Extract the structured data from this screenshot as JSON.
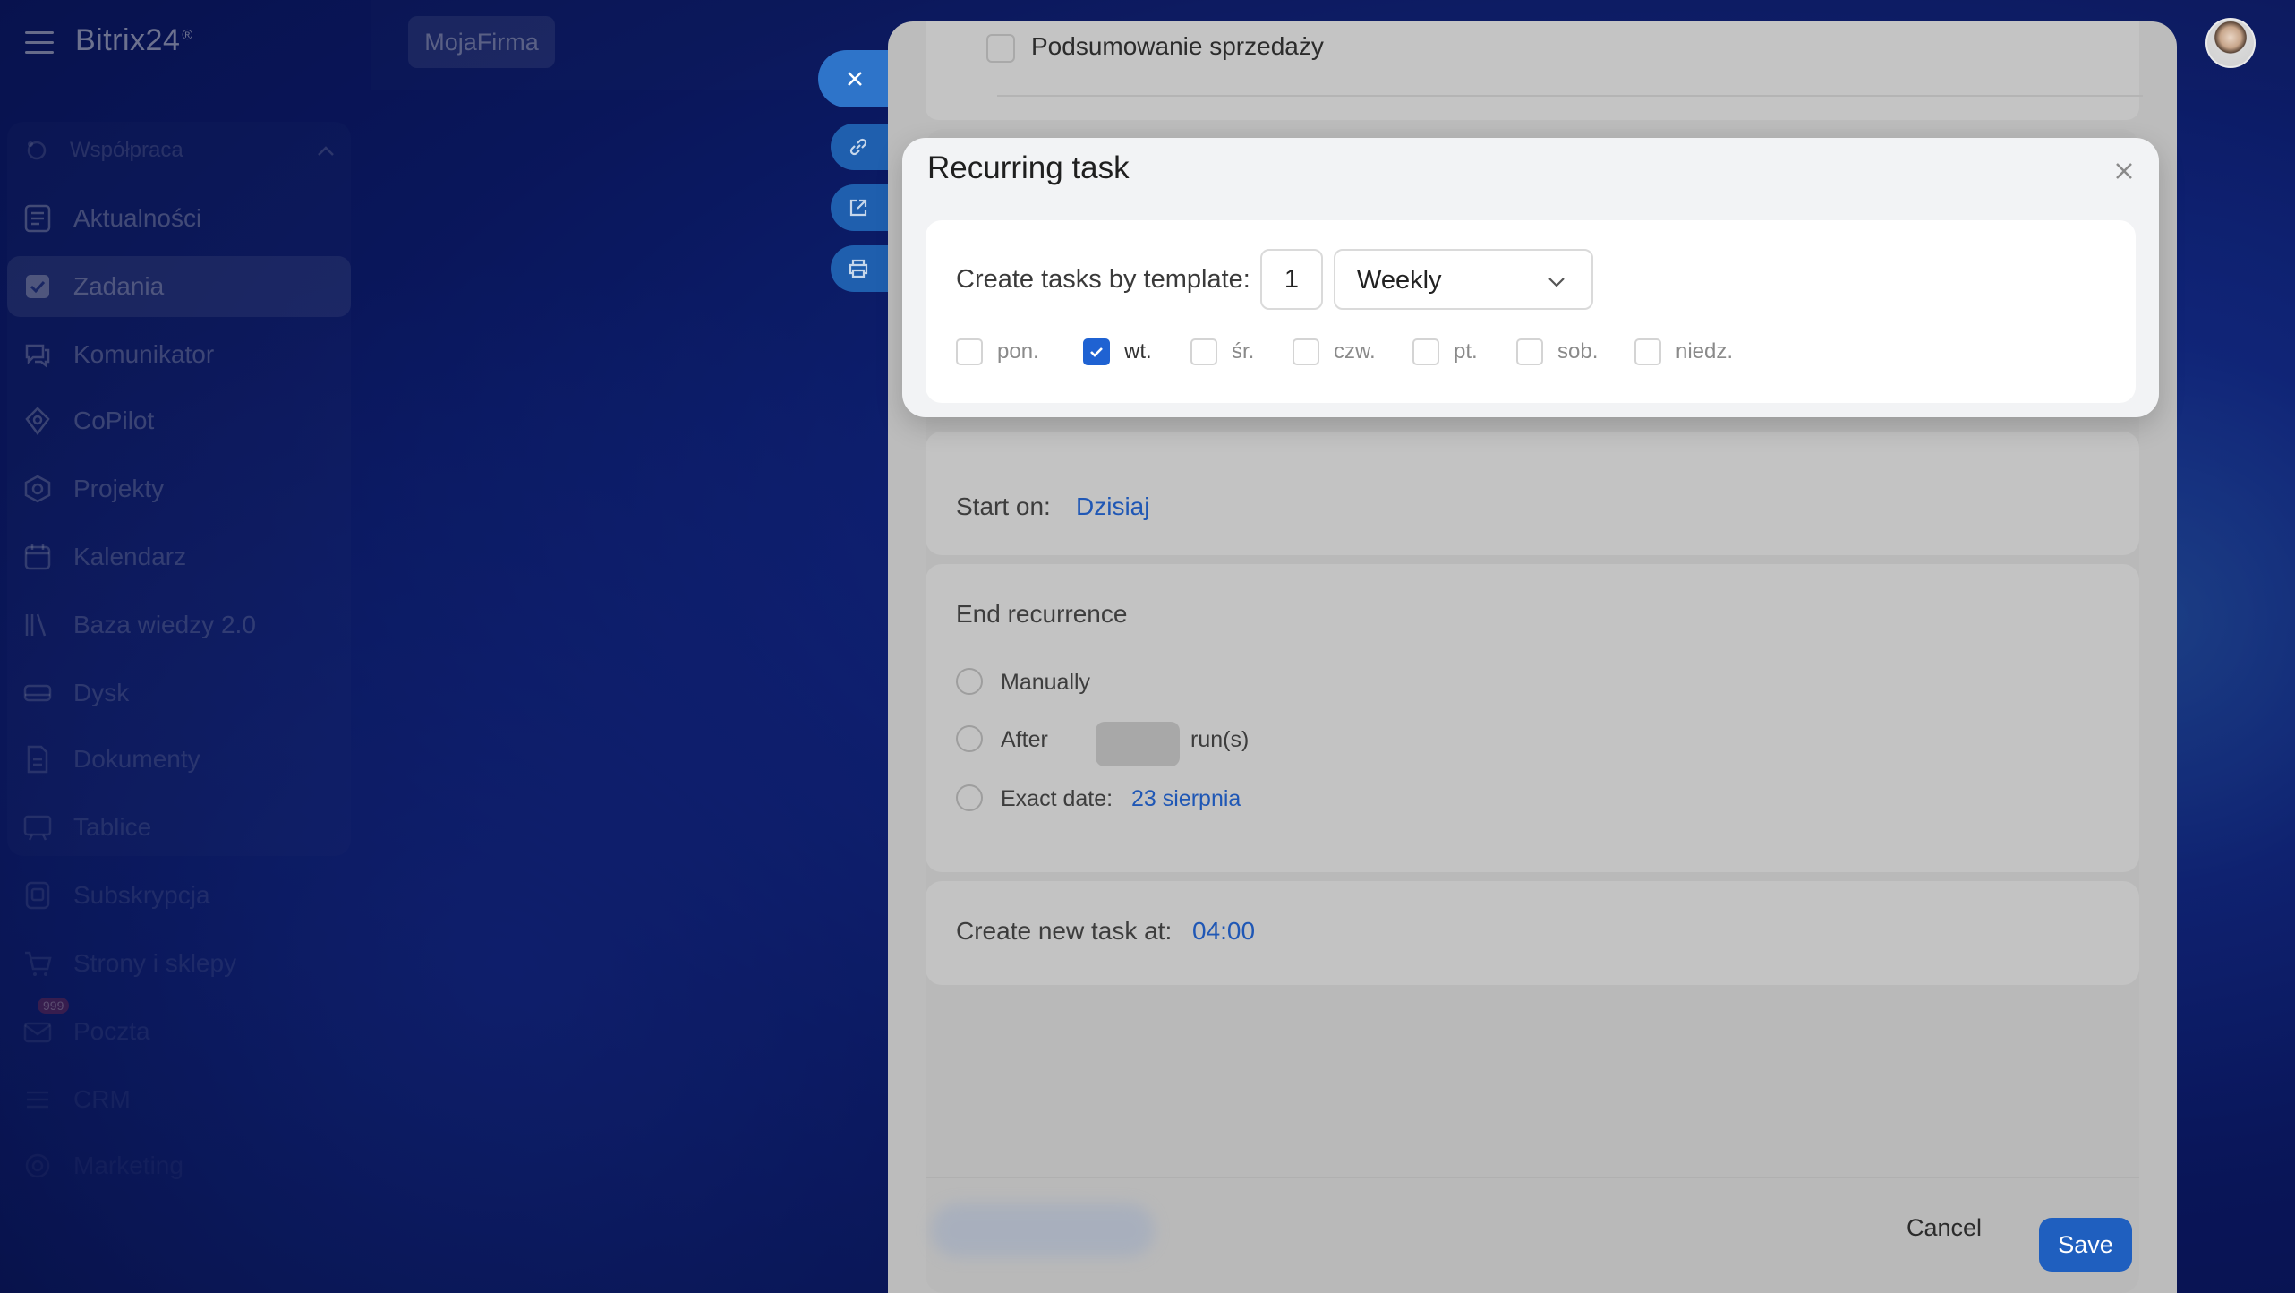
{
  "app": {
    "brand": "Bitrix24",
    "brand_mark": "®",
    "company": "MojaFirma"
  },
  "sidebar": {
    "group_label": "Współpraca",
    "items": [
      {
        "label": "Aktualności",
        "icon": "newsfeed-icon"
      },
      {
        "label": "Zadania",
        "icon": "tasks-checkbox-icon",
        "active": true
      },
      {
        "label": "Komunikator",
        "icon": "chat-icon"
      },
      {
        "label": "CoPilot",
        "icon": "copilot-icon"
      },
      {
        "label": "Projekty",
        "icon": "projects-icon"
      },
      {
        "label": "Kalendarz",
        "icon": "calendar-icon"
      },
      {
        "label": "Baza wiedzy 2.0",
        "icon": "knowledge-base-icon"
      },
      {
        "label": "Dysk",
        "icon": "drive-icon"
      },
      {
        "label": "Dokumenty",
        "icon": "document-icon"
      },
      {
        "label": "Tablice",
        "icon": "board-icon"
      },
      {
        "label": "Subskrypcja",
        "icon": "subscription-icon"
      },
      {
        "label": "Strony i sklepy",
        "icon": "cart-icon"
      },
      {
        "label": "Poczta",
        "icon": "mail-icon",
        "badge": "999"
      },
      {
        "label": "CRM",
        "icon": "crm-icon"
      },
      {
        "label": "Marketing",
        "icon": "marketing-icon"
      }
    ]
  },
  "slider": {
    "summary_label": "Podsumowanie sprzedaży",
    "start_on_label": "Start on:",
    "start_on_value": "Dzisiaj",
    "end_recurrence_title": "End recurrence",
    "end_options": {
      "manually": "Manually",
      "after": "After",
      "runs_suffix": "run(s)",
      "exact_date": "Exact date:",
      "exact_date_value": "23 sierpnia"
    },
    "create_new_label": "Create new task at:",
    "create_new_time": "04:00",
    "cancel_label": "Cancel",
    "save_label": "Save"
  },
  "modal": {
    "title": "Recurring task",
    "template_label": "Create tasks by template:",
    "interval_value": "1",
    "frequency": "Weekly",
    "days": [
      {
        "label": "pon.",
        "checked": false
      },
      {
        "label": "wt.",
        "checked": true
      },
      {
        "label": "śr.",
        "checked": false
      },
      {
        "label": "czw.",
        "checked": false
      },
      {
        "label": "pt.",
        "checked": false
      },
      {
        "label": "sob.",
        "checked": false
      },
      {
        "label": "niedz.",
        "checked": false
      }
    ]
  },
  "colors": {
    "accent": "#1f5fbf",
    "link": "#1f57b5",
    "checkbox_on": "#1f62d2"
  }
}
